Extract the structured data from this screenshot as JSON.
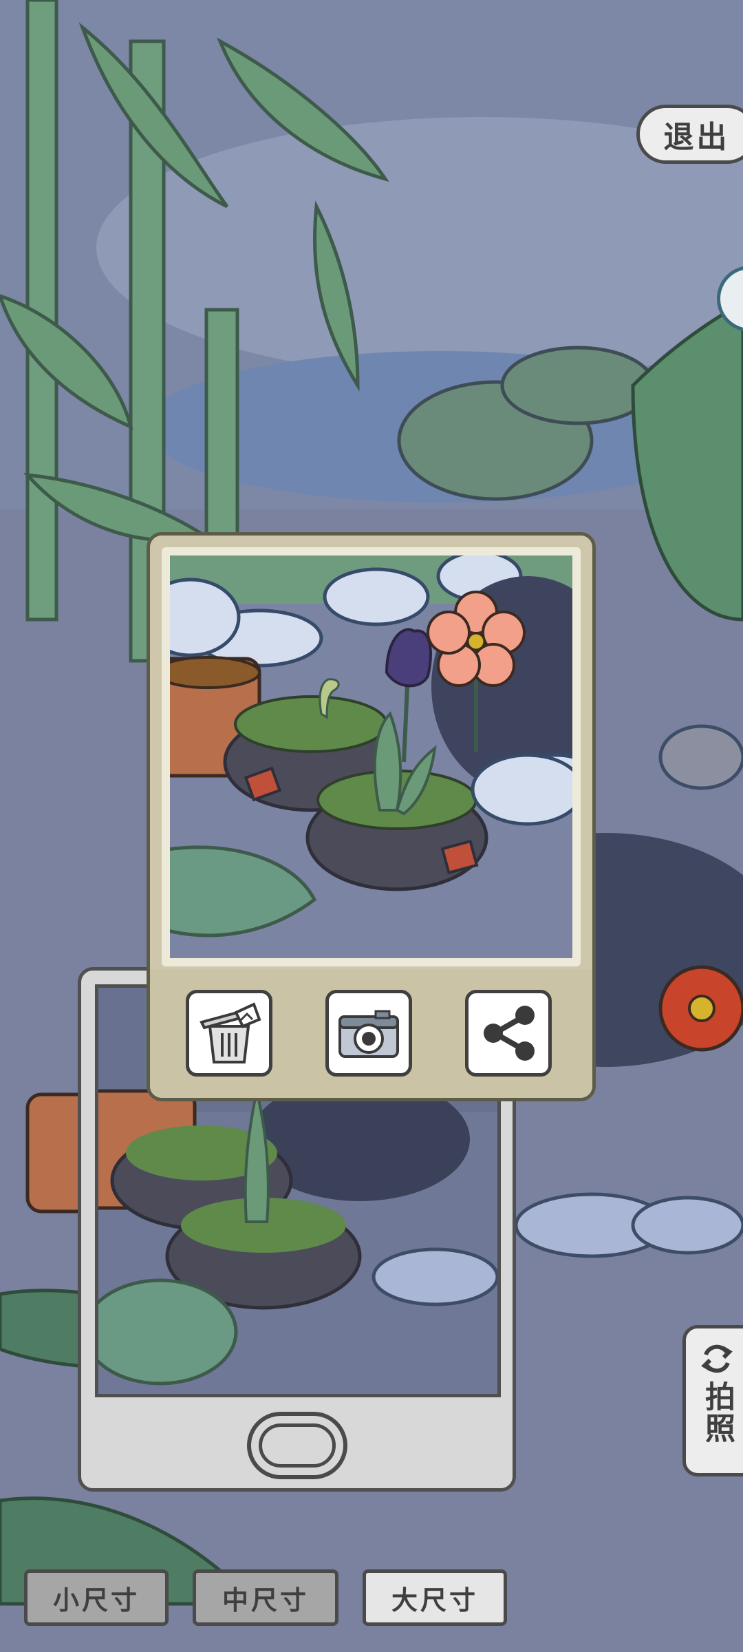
{
  "header": {
    "exit_label": "退出"
  },
  "photo_card": {
    "actions": [
      {
        "name": "delete",
        "icon": "trash-icon"
      },
      {
        "name": "save",
        "icon": "camera-icon"
      },
      {
        "name": "share",
        "icon": "share-icon"
      }
    ]
  },
  "side": {
    "photo_label": "拍照",
    "icon": "refresh-icon"
  },
  "sizes": {
    "small": "小尺寸",
    "medium": "中尺寸",
    "large": "大尺寸",
    "selected": "large"
  },
  "colors": {
    "scene": "#7d87a6",
    "card": "#cfc7ab",
    "button_active": "#e6e6e6",
    "button_inactive": "#a6a6a6"
  }
}
